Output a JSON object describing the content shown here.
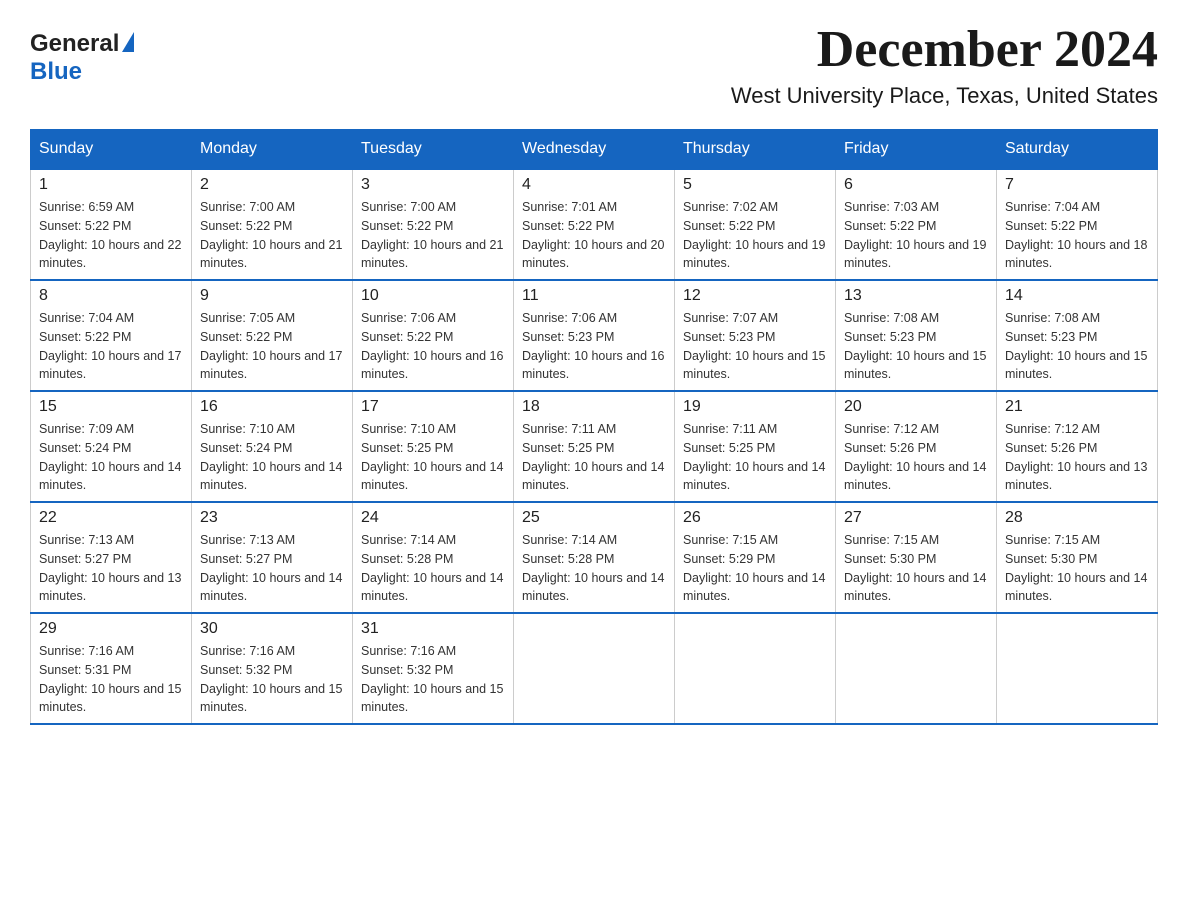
{
  "logo": {
    "general": "General",
    "blue": "Blue"
  },
  "title": "December 2024",
  "subtitle": "West University Place, Texas, United States",
  "days": [
    "Sunday",
    "Monday",
    "Tuesday",
    "Wednesday",
    "Thursday",
    "Friday",
    "Saturday"
  ],
  "weeks": [
    [
      {
        "day": "1",
        "sunrise": "6:59 AM",
        "sunset": "5:22 PM",
        "daylight": "10 hours and 22 minutes."
      },
      {
        "day": "2",
        "sunrise": "7:00 AM",
        "sunset": "5:22 PM",
        "daylight": "10 hours and 21 minutes."
      },
      {
        "day": "3",
        "sunrise": "7:00 AM",
        "sunset": "5:22 PM",
        "daylight": "10 hours and 21 minutes."
      },
      {
        "day": "4",
        "sunrise": "7:01 AM",
        "sunset": "5:22 PM",
        "daylight": "10 hours and 20 minutes."
      },
      {
        "day": "5",
        "sunrise": "7:02 AM",
        "sunset": "5:22 PM",
        "daylight": "10 hours and 19 minutes."
      },
      {
        "day": "6",
        "sunrise": "7:03 AM",
        "sunset": "5:22 PM",
        "daylight": "10 hours and 19 minutes."
      },
      {
        "day": "7",
        "sunrise": "7:04 AM",
        "sunset": "5:22 PM",
        "daylight": "10 hours and 18 minutes."
      }
    ],
    [
      {
        "day": "8",
        "sunrise": "7:04 AM",
        "sunset": "5:22 PM",
        "daylight": "10 hours and 17 minutes."
      },
      {
        "day": "9",
        "sunrise": "7:05 AM",
        "sunset": "5:22 PM",
        "daylight": "10 hours and 17 minutes."
      },
      {
        "day": "10",
        "sunrise": "7:06 AM",
        "sunset": "5:22 PM",
        "daylight": "10 hours and 16 minutes."
      },
      {
        "day": "11",
        "sunrise": "7:06 AM",
        "sunset": "5:23 PM",
        "daylight": "10 hours and 16 minutes."
      },
      {
        "day": "12",
        "sunrise": "7:07 AM",
        "sunset": "5:23 PM",
        "daylight": "10 hours and 15 minutes."
      },
      {
        "day": "13",
        "sunrise": "7:08 AM",
        "sunset": "5:23 PM",
        "daylight": "10 hours and 15 minutes."
      },
      {
        "day": "14",
        "sunrise": "7:08 AM",
        "sunset": "5:23 PM",
        "daylight": "10 hours and 15 minutes."
      }
    ],
    [
      {
        "day": "15",
        "sunrise": "7:09 AM",
        "sunset": "5:24 PM",
        "daylight": "10 hours and 14 minutes."
      },
      {
        "day": "16",
        "sunrise": "7:10 AM",
        "sunset": "5:24 PM",
        "daylight": "10 hours and 14 minutes."
      },
      {
        "day": "17",
        "sunrise": "7:10 AM",
        "sunset": "5:25 PM",
        "daylight": "10 hours and 14 minutes."
      },
      {
        "day": "18",
        "sunrise": "7:11 AM",
        "sunset": "5:25 PM",
        "daylight": "10 hours and 14 minutes."
      },
      {
        "day": "19",
        "sunrise": "7:11 AM",
        "sunset": "5:25 PM",
        "daylight": "10 hours and 14 minutes."
      },
      {
        "day": "20",
        "sunrise": "7:12 AM",
        "sunset": "5:26 PM",
        "daylight": "10 hours and 14 minutes."
      },
      {
        "day": "21",
        "sunrise": "7:12 AM",
        "sunset": "5:26 PM",
        "daylight": "10 hours and 13 minutes."
      }
    ],
    [
      {
        "day": "22",
        "sunrise": "7:13 AM",
        "sunset": "5:27 PM",
        "daylight": "10 hours and 13 minutes."
      },
      {
        "day": "23",
        "sunrise": "7:13 AM",
        "sunset": "5:27 PM",
        "daylight": "10 hours and 14 minutes."
      },
      {
        "day": "24",
        "sunrise": "7:14 AM",
        "sunset": "5:28 PM",
        "daylight": "10 hours and 14 minutes."
      },
      {
        "day": "25",
        "sunrise": "7:14 AM",
        "sunset": "5:28 PM",
        "daylight": "10 hours and 14 minutes."
      },
      {
        "day": "26",
        "sunrise": "7:15 AM",
        "sunset": "5:29 PM",
        "daylight": "10 hours and 14 minutes."
      },
      {
        "day": "27",
        "sunrise": "7:15 AM",
        "sunset": "5:30 PM",
        "daylight": "10 hours and 14 minutes."
      },
      {
        "day": "28",
        "sunrise": "7:15 AM",
        "sunset": "5:30 PM",
        "daylight": "10 hours and 14 minutes."
      }
    ],
    [
      {
        "day": "29",
        "sunrise": "7:16 AM",
        "sunset": "5:31 PM",
        "daylight": "10 hours and 15 minutes."
      },
      {
        "day": "30",
        "sunrise": "7:16 AM",
        "sunset": "5:32 PM",
        "daylight": "10 hours and 15 minutes."
      },
      {
        "day": "31",
        "sunrise": "7:16 AM",
        "sunset": "5:32 PM",
        "daylight": "10 hours and 15 minutes."
      },
      null,
      null,
      null,
      null
    ]
  ]
}
